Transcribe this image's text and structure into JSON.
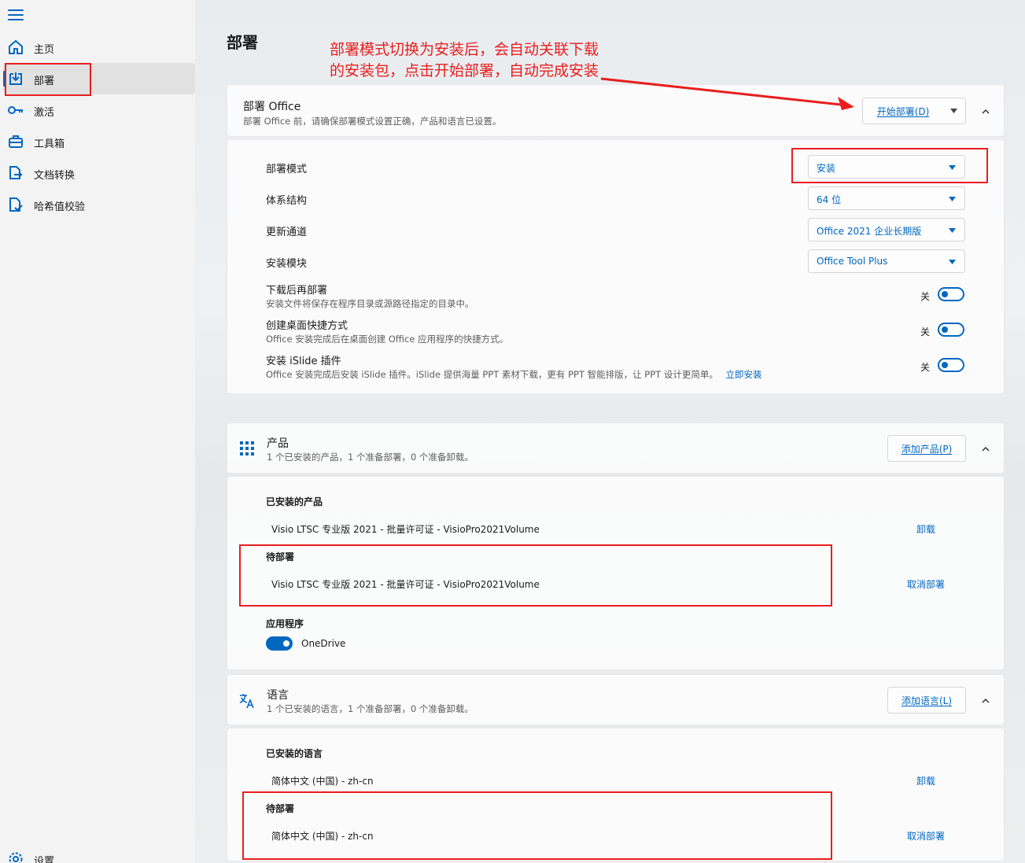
{
  "sidebar": {
    "items": [
      {
        "label": "主页",
        "icon": "home-icon"
      },
      {
        "label": "部署",
        "icon": "deploy-icon"
      },
      {
        "label": "激活",
        "icon": "key-icon"
      },
      {
        "label": "工具箱",
        "icon": "toolbox-icon"
      },
      {
        "label": "文档转换",
        "icon": "document-convert-icon"
      },
      {
        "label": "哈希值校验",
        "icon": "hash-check-icon"
      }
    ],
    "settings_label": "设置"
  },
  "page": {
    "title": "部署"
  },
  "annotation": "部署模式切换为安装后，会自动关联下载的安装包，点击开始部署，自动完成安装",
  "deploy_card": {
    "title": "部署 Office",
    "subtitle": "部署 Office 前，请确保部署模式设置正确，产品和语言已设置。",
    "start_button": "开始部署(D)"
  },
  "settings": {
    "mode_label": "部署模式",
    "mode_value": "安装",
    "arch_label": "体系结构",
    "arch_value": "64 位",
    "channel_label": "更新通道",
    "channel_value": "Office 2021 企业长期版",
    "module_label": "安装模块",
    "module_value": "Office Tool Plus",
    "toggles": [
      {
        "label": "下载后再部署",
        "sub": "安装文件将保存在程序目录或源路径指定的目录中。",
        "state": "关"
      },
      {
        "label": "创建桌面快捷方式",
        "sub": "Office 安装完成后在桌面创建 Office 应用程序的快捷方式。",
        "state": "关"
      },
      {
        "label": "安装 iSlide 插件",
        "sub": "Office 安装完成后安装 iSlide 插件。iSlide 提供海量 PPT 素材下载，更有 PPT 智能排版，让 PPT 设计更简单。",
        "state": "关",
        "link": "立即安装"
      }
    ]
  },
  "products": {
    "title": "产品",
    "subtitle": "1 个已安装的产品，1 个准备部署，0 个准备卸载。",
    "add_button": "添加产品(P)",
    "installed_title": "已安装的产品",
    "installed_item": "Visio LTSC 专业版 2021 - 批量许可证  -  VisioPro2021Volume",
    "installed_action": "卸载",
    "pending_title": "待部署",
    "pending_item": "Visio LTSC 专业版 2021 - 批量许可证  -  VisioPro2021Volume",
    "pending_action": "取消部署",
    "apps_title": "应用程序",
    "app_name": "OneDrive"
  },
  "languages": {
    "title": "语言",
    "subtitle": "1 个已安装的语言，1 个准备部署，0 个准备卸载。",
    "add_button": "添加语言(L)",
    "installed_title": "已安装的语言",
    "installed_item": "简体中文 (中国)  -  zh-cn",
    "installed_action": "卸载",
    "pending_title": "待部署",
    "pending_item": "简体中文 (中国)  -  zh-cn",
    "pending_action": "取消部署"
  },
  "colors": {
    "accent": "#0067c0",
    "annotation_red": "#e81e1e"
  }
}
